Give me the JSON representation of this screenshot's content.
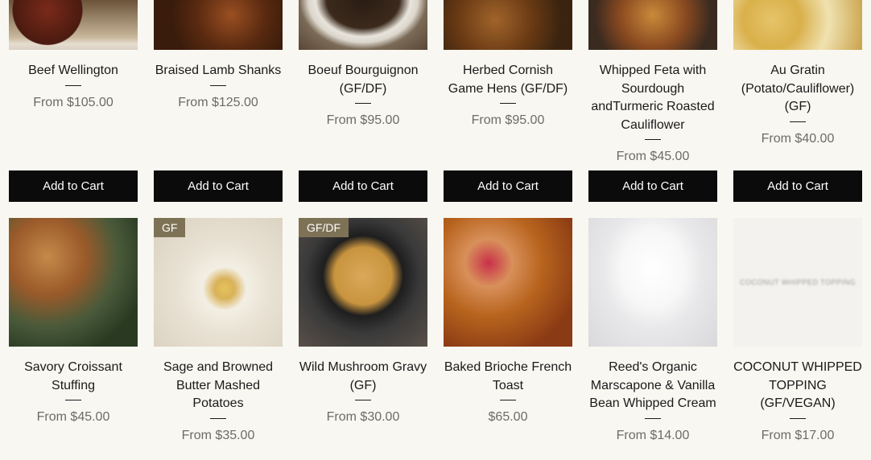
{
  "products_row1": [
    {
      "title": "Beef Wellington",
      "price": "From $105.00",
      "button": "Add to Cart"
    },
    {
      "title": "Braised Lamb Shanks",
      "price": "From $125.00",
      "button": "Add to Cart"
    },
    {
      "title": "Boeuf Bourguignon (GF/DF)",
      "price": "From $95.00",
      "button": "Add to Cart"
    },
    {
      "title": "Herbed Cornish Game Hens (GF/DF)",
      "price": "From $95.00",
      "button": "Add to Cart"
    },
    {
      "title": "Whipped Feta with Sourdough andTurmeric Roasted Cauliflower",
      "price": "From $45.00",
      "button": "Add to Cart"
    },
    {
      "title": "Au Gratin (Potato/Cauliflower) (GF)",
      "price": "From $40.00",
      "button": "Add to Cart"
    }
  ],
  "products_row2": [
    {
      "title": "Savory Croissant Stuffing",
      "price": "From $45.00"
    },
    {
      "title": "Sage and Browned Butter Mashed Potatoes",
      "price": "From $35.00",
      "badge": "GF"
    },
    {
      "title": "Wild Mushroom Gravy (GF)",
      "price": "From $30.00",
      "badge": "GF/DF"
    },
    {
      "title": "Baked Brioche French Toast",
      "price": "$65.00"
    },
    {
      "title": "Reed's Organic Marscapone & Vanilla Bean Whipped Cream",
      "price": "From $14.00"
    },
    {
      "title": "COCONUT WHIPPED TOPPING (GF/VEGAN)",
      "price": "From $17.00",
      "image_placeholder": "COCONUT WHIPPED TOPPING"
    }
  ]
}
